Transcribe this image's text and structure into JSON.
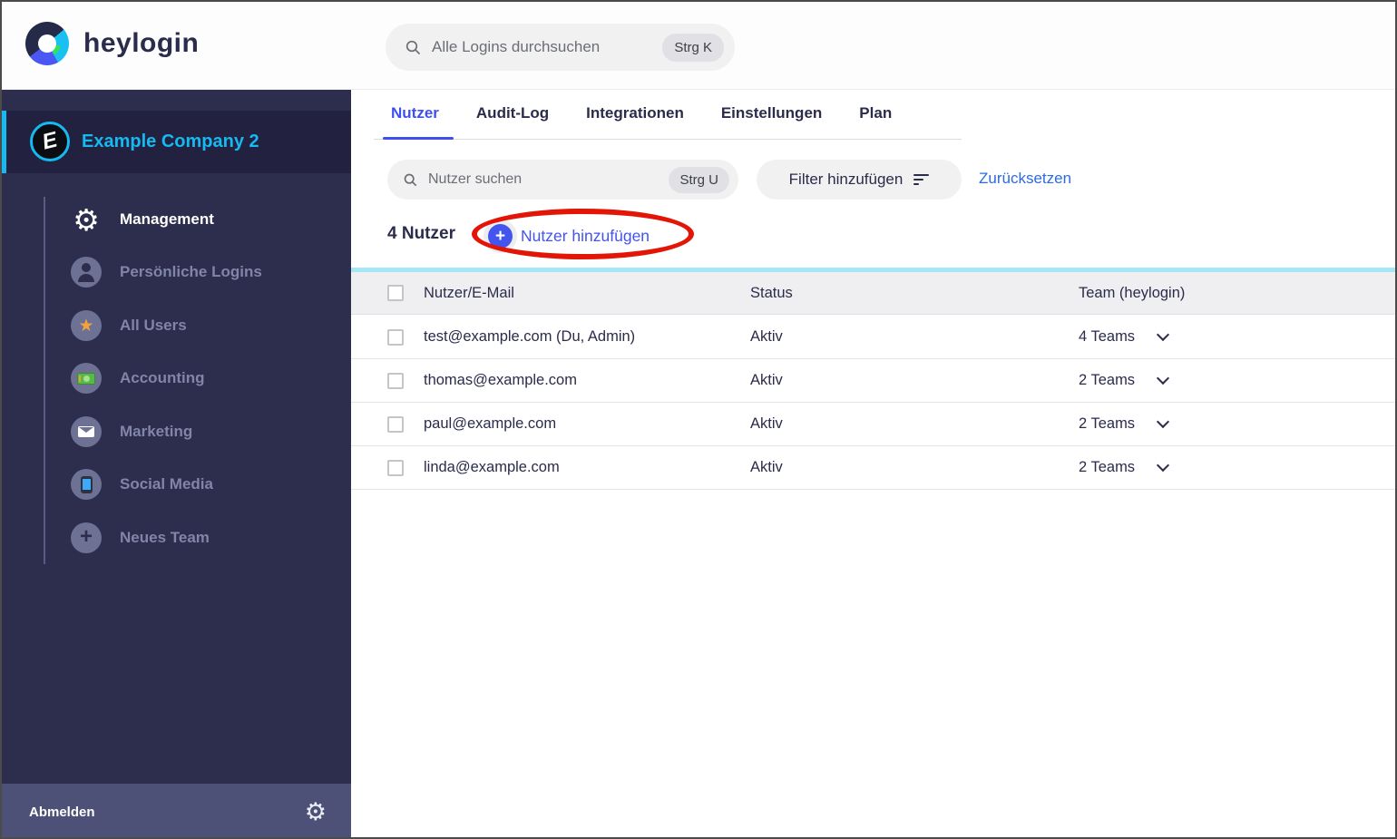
{
  "colors": {
    "sidebar_navy": "#2d2d4d",
    "accent_cyan": "#16b9f0",
    "accent_indigo": "#4354ef",
    "link_blue": "#2c6bdf",
    "annotation_red": "#e31507",
    "table_header_bg": "#efeff1",
    "cyan_divider": "#a5e6f7"
  },
  "topbar": {
    "brand": "heylogin",
    "search": {
      "placeholder": "Alle Logins durchsuchen",
      "shortcut": "Strg K",
      "icon": "search-icon"
    }
  },
  "sidebar": {
    "company": {
      "name": "Example Company 2",
      "monogram": "E"
    },
    "items": [
      {
        "label": "Management",
        "icon": "gear-icon",
        "active": true
      },
      {
        "label": "Persönliche Logins",
        "icon": "person-icon",
        "active": false
      },
      {
        "label": "All Users",
        "icon": "star-icon",
        "active": false
      },
      {
        "label": "Accounting",
        "icon": "banknote-icon",
        "active": false
      },
      {
        "label": "Marketing",
        "icon": "envelope-icon",
        "active": false
      },
      {
        "label": "Social Media",
        "icon": "phone-icon",
        "active": false
      },
      {
        "label": "Neues Team",
        "icon": "plus-icon",
        "active": false
      }
    ],
    "footer": {
      "logout": "Abmelden",
      "settings_icon": "gear-icon"
    }
  },
  "main": {
    "tabs": [
      {
        "label": "Nutzer",
        "active": true
      },
      {
        "label": "Audit-Log",
        "active": false
      },
      {
        "label": "Integrationen",
        "active": false
      },
      {
        "label": "Einstellungen",
        "active": false
      },
      {
        "label": "Plan",
        "active": false
      }
    ],
    "toolbar": {
      "search": {
        "placeholder": "Nutzer suchen",
        "shortcut": "Strg U",
        "icon": "search-icon"
      },
      "filter_button": "Filter hinzufügen",
      "reset_link": "Zurücksetzen"
    },
    "count": "4 Nutzer",
    "add_button": "Nutzer hinzufügen",
    "annotation": {
      "shape": "red-ellipse",
      "color": "#e31507",
      "around": "Nutzer hinzufügen"
    },
    "table": {
      "headers": [
        "Nutzer/E-Mail",
        "Status",
        "Team (heylogin)"
      ],
      "rows": [
        {
          "email": "test@example.com (Du, Admin)",
          "status": "Aktiv",
          "teams": "4 Teams"
        },
        {
          "email": "thomas@example.com",
          "status": "Aktiv",
          "teams": "2 Teams"
        },
        {
          "email": "paul@example.com",
          "status": "Aktiv",
          "teams": "2 Teams"
        },
        {
          "email": "linda@example.com",
          "status": "Aktiv",
          "teams": "2 Teams"
        }
      ]
    }
  }
}
